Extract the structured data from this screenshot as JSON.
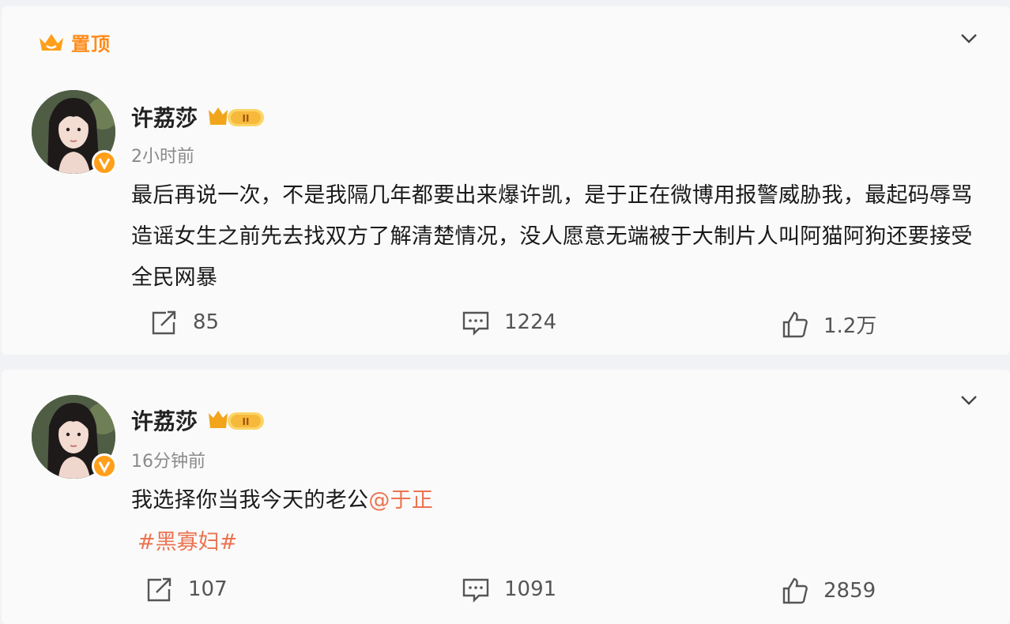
{
  "posts": [
    {
      "pinned_label": "置顶",
      "author": "许荔莎",
      "time": "2小时前",
      "text": "最后再说一次，不是我隔几年都要出来爆许凯，是于正在微博用报警威胁我，最起码辱骂造谣女生之前先去找双方了解清楚情况，没人愿意无端被于大制片人叫阿猫阿狗还要接受全民网暴",
      "reposts": "85",
      "comments": "1224",
      "likes": "1.2万"
    },
    {
      "author": "许荔莎",
      "time": "16分钟前",
      "text": "我选择你当我今天的老公",
      "mention": "@于正",
      "topic": "#黑寡妇#",
      "reposts": "107",
      "comments": "1091",
      "likes": "2859"
    }
  ],
  "icons": {
    "pin": "crown-icon",
    "more": "chevron-down-icon",
    "verified": "verified-v-icon",
    "vip": "vip-crown-badge-icon",
    "repost": "repost-icon",
    "comment": "comment-icon",
    "like": "thumbs-up-icon"
  },
  "colors": {
    "accent": "#ff8c1a",
    "link": "#eb7350",
    "muted": "#8a8a8a"
  }
}
